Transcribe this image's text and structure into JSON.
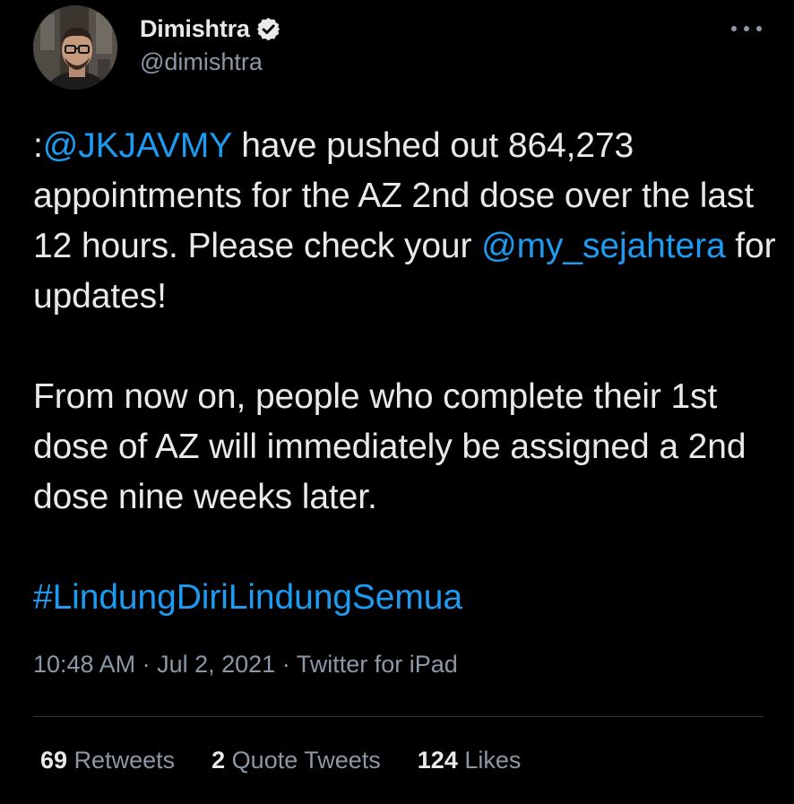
{
  "author": {
    "display_name": "Dimishtra",
    "handle": "@dimishtra",
    "verified": true
  },
  "menu_icon": "more-horizontal-icon",
  "tweet": {
    "line1_prefix": ":",
    "mention1": "@JKJAVMY",
    "line1_rest": " have pushed out 864,273 appointments for the AZ 2nd dose over the last 12 hours. Please check your ",
    "mention2": "@my_sejahtera",
    "line1_tail": " for updates!",
    "paragraph2": "From now on, people who complete their 1st dose of AZ will immediately be assigned a 2nd dose nine weeks later.",
    "hashtag": "#LindungDiriLindungSemua"
  },
  "meta": {
    "time": "10:48 AM",
    "sep1": " · ",
    "date": "Jul 2, 2021",
    "sep2": " · ",
    "source": "Twitter for iPad"
  },
  "stats": {
    "retweets_count": "69",
    "retweets_label": "Retweets",
    "quotes_count": "2",
    "quotes_label": "Quote Tweets",
    "likes_count": "124",
    "likes_label": "Likes"
  },
  "colors": {
    "background": "#000000",
    "text": "#e7e9ea",
    "secondary": "#8b98a5",
    "link": "#1d9bf0",
    "divider": "#2f3336"
  }
}
